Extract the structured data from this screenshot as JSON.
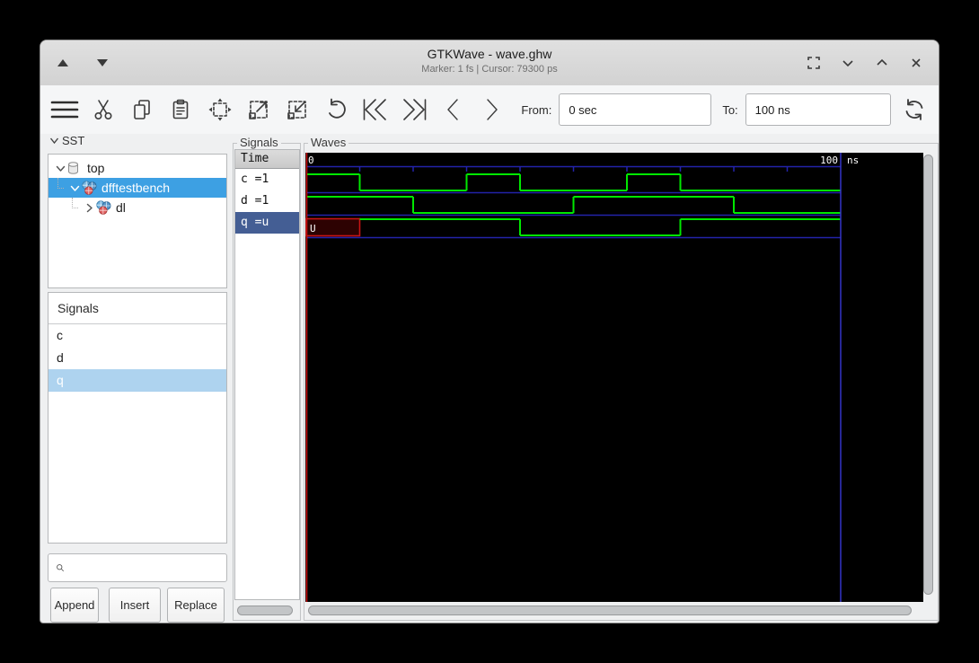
{
  "window": {
    "title": "GTKWave - wave.ghw",
    "subtitle": "Marker: 1 fs  |  Cursor: 79300 ps"
  },
  "toolbar": {
    "icons": [
      "menu",
      "cut",
      "copy",
      "paste",
      "zoom-fit",
      "zoom-in",
      "zoom-out",
      "undo",
      "go-first",
      "go-last",
      "go-previous",
      "go-next",
      "reload"
    ],
    "from_label": "From:",
    "from_value": "0 sec",
    "to_label": "To:",
    "to_value": "100 ns"
  },
  "sst": {
    "label": "SST",
    "tree": [
      {
        "label": "top",
        "expanded": true,
        "icon": "cylinder",
        "selected": false
      },
      {
        "label": "dfftestbench",
        "expanded": true,
        "icon": "module",
        "selected": true
      },
      {
        "label": "dl",
        "expanded": false,
        "icon": "module",
        "selected": false
      }
    ]
  },
  "signals_panel": {
    "header": "Signals",
    "items": [
      {
        "label": "c",
        "selected": false
      },
      {
        "label": "d",
        "selected": false
      },
      {
        "label": "q",
        "selected": true
      }
    ],
    "search_value": "",
    "buttons": {
      "append": "Append",
      "insert": "Insert",
      "replace": "Replace"
    }
  },
  "signal_column": {
    "frame_label": "Signals",
    "header": "Time",
    "rows": [
      {
        "label": "c =1",
        "selected": false
      },
      {
        "label": "d =1",
        "selected": false
      },
      {
        "label": "q =u",
        "selected": true
      }
    ]
  },
  "waves": {
    "frame_label": "Waves"
  },
  "chart_data": {
    "type": "digital-waveform",
    "time_unit": "ns",
    "time_range_ns": [
      0,
      100
    ],
    "ticks_ns": [
      10,
      20,
      30,
      40,
      50,
      60,
      70,
      80,
      90
    ],
    "timeline_labels": {
      "start": "0",
      "end_value": "100",
      "end_unit": "ns"
    },
    "marker_time_ns": 1e-06,
    "marker_label": "1 fs",
    "cursor_label": "79300 ps",
    "signals": [
      {
        "name": "c",
        "value_at_marker": "1",
        "segments": [
          {
            "t0": 0,
            "t1": 10,
            "v": "1"
          },
          {
            "t0": 10,
            "t1": 30,
            "v": "0"
          },
          {
            "t0": 30,
            "t1": 40,
            "v": "1"
          },
          {
            "t0": 40,
            "t1": 60,
            "v": "0"
          },
          {
            "t0": 60,
            "t1": 70,
            "v": "1"
          },
          {
            "t0": 70,
            "t1": 100,
            "v": "0"
          }
        ]
      },
      {
        "name": "d",
        "value_at_marker": "1",
        "segments": [
          {
            "t0": 0,
            "t1": 20,
            "v": "1"
          },
          {
            "t0": 20,
            "t1": 50,
            "v": "0"
          },
          {
            "t0": 50,
            "t1": 80,
            "v": "1"
          },
          {
            "t0": 80,
            "t1": 100,
            "v": "0"
          }
        ]
      },
      {
        "name": "q",
        "value_at_marker": "u",
        "segments": [
          {
            "t0": 0,
            "t1": 10,
            "v": "U"
          },
          {
            "t0": 10,
            "t1": 40,
            "v": "1"
          },
          {
            "t0": 40,
            "t1": 70,
            "v": "0"
          },
          {
            "t0": 70,
            "t1": 100,
            "v": "1"
          }
        ]
      }
    ],
    "colors": {
      "background": "#000000",
      "wave": "#00e800",
      "grid": "#2323aa",
      "end_line": "#3434c8",
      "marker": "#cc1010",
      "undefined_fill": "#2d0202",
      "undefined_stroke": "#c81414",
      "label_text": "#ffffff"
    }
  }
}
